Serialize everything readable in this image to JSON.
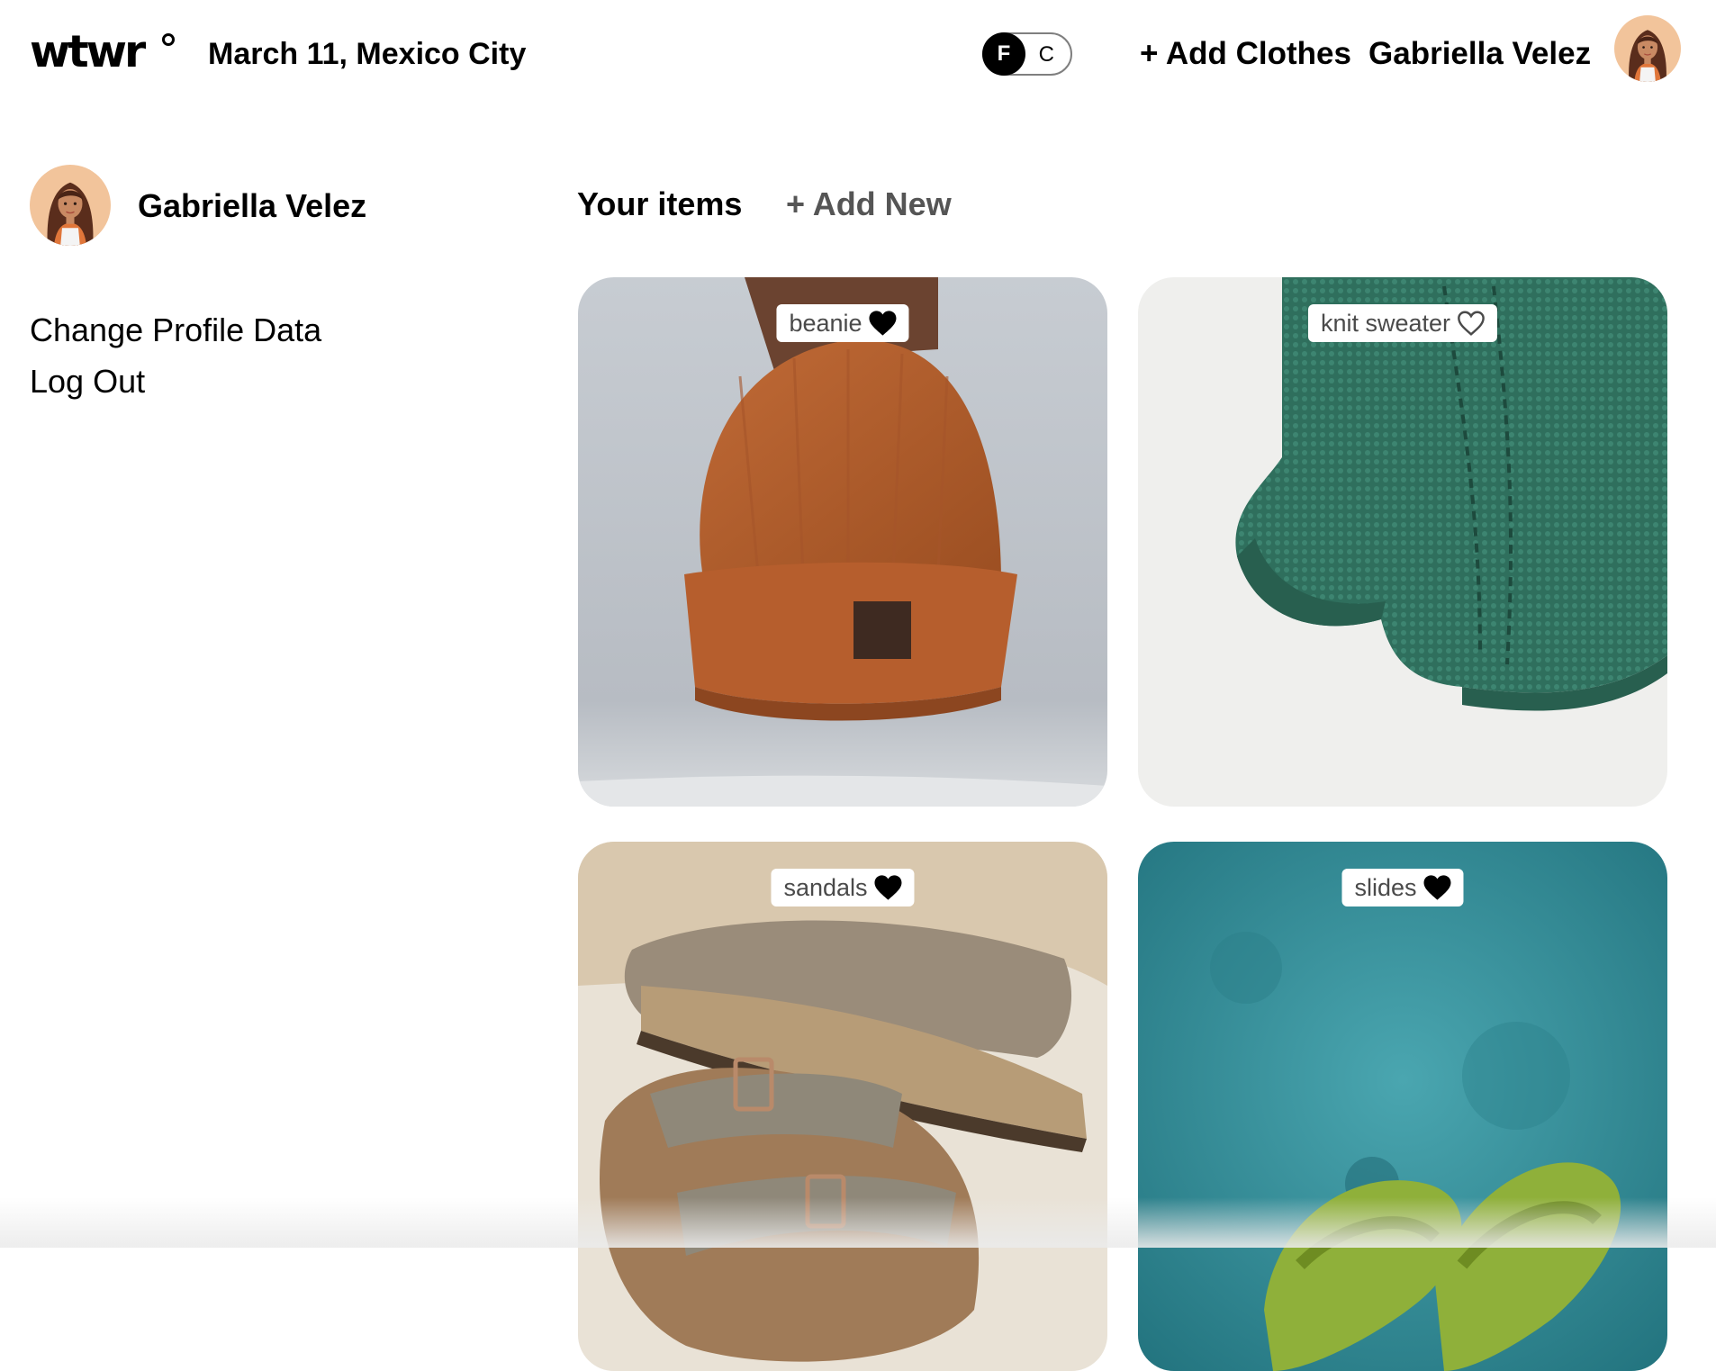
{
  "header": {
    "logo": "wtwr",
    "date_location": "March 11, Mexico City",
    "temp_toggle": {
      "left": "F",
      "right": "C",
      "active": "F"
    },
    "add_clothes": "+ Add Clothes",
    "user_name": "Gabriella Velez"
  },
  "sidebar": {
    "user_name": "Gabriella Velez",
    "links": [
      "Change Profile Data",
      "Log Out"
    ]
  },
  "main": {
    "title": "Your items",
    "add_new": "+ Add New",
    "items": [
      {
        "name": "beanie",
        "liked": true
      },
      {
        "name": "knit sweater",
        "liked": false
      },
      {
        "name": "sandals",
        "liked": true
      },
      {
        "name": "slides",
        "liked": true
      }
    ]
  },
  "colors": {
    "background": "#ffffff",
    "text": "#000000",
    "muted": "#555555",
    "tag_text": "#4a4a4a"
  }
}
